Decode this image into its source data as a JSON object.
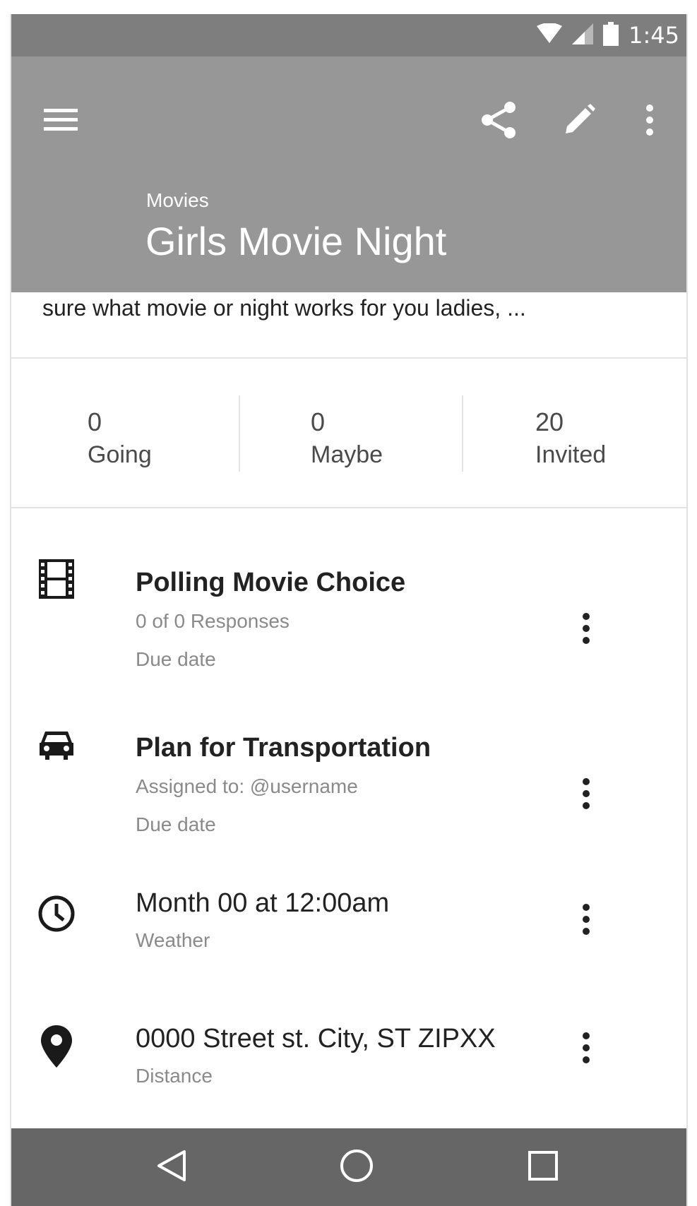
{
  "status_bar": {
    "time": "1:45",
    "icons": [
      "wifi-icon",
      "signal-icon",
      "battery-icon"
    ]
  },
  "app_bar": {
    "category": "Movies",
    "title": "Girls Movie Night",
    "icons": [
      "menu-icon",
      "share-icon",
      "edit-icon",
      "more-vert-icon"
    ],
    "background": "#979797"
  },
  "description": "sure what movie or night works for you ladies, ...",
  "stats": [
    {
      "count": "0",
      "label": "Going"
    },
    {
      "count": "0",
      "label": "Maybe"
    },
    {
      "count": "20",
      "label": "Invited"
    }
  ],
  "items": [
    {
      "icon": "film-icon",
      "title": "Polling Movie Choice",
      "lines": [
        "0 of 0 Responses",
        "Due date"
      ]
    },
    {
      "icon": "car-icon",
      "title": "Plan for Transportation",
      "lines": [
        "Assigned to: @username",
        "Due date"
      ]
    },
    {
      "icon": "clock-icon",
      "title": "Month 00 at 12:00am",
      "lines": [
        "Weather"
      ]
    },
    {
      "icon": "location-pin-icon",
      "title": "0000 Street st. City, ST ZIPXX",
      "lines": [
        "Distance"
      ]
    }
  ],
  "nav_bar": {
    "buttons": [
      "back-icon",
      "home-icon",
      "recents-icon"
    ]
  }
}
